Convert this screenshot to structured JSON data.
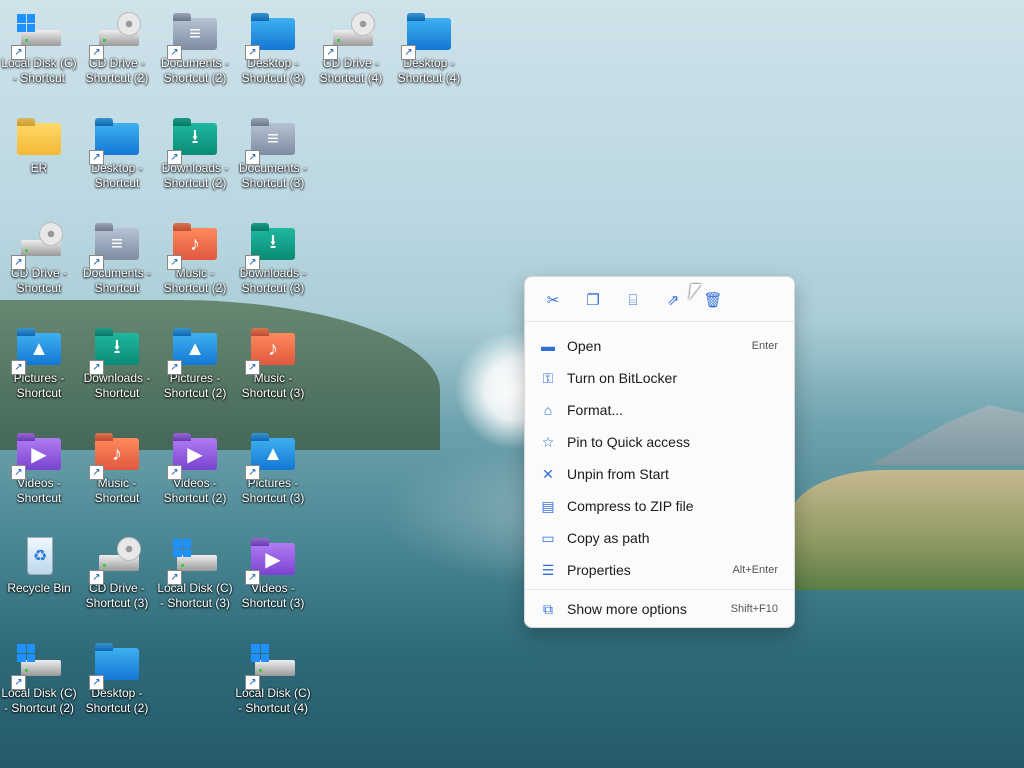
{
  "desktop": {
    "icons": [
      {
        "label": "Local Disk (C) - Shortcut",
        "kind": "win-drive",
        "shortcut": true
      },
      {
        "label": "CD Drive - Shortcut (2)",
        "kind": "cd-drive",
        "shortcut": true
      },
      {
        "label": "Documents - Shortcut (2)",
        "kind": "folder-docs",
        "shortcut": true
      },
      {
        "label": "Desktop - Shortcut (3)",
        "kind": "folder-blue",
        "shortcut": true
      },
      {
        "label": "CD Drive - Shortcut (4)",
        "kind": "cd-drive",
        "shortcut": true
      },
      {
        "label": "Desktop - Shortcut (4)",
        "kind": "folder-blue",
        "shortcut": true
      },
      {
        "label": "ER",
        "kind": "folder-yellow",
        "shortcut": false
      },
      {
        "label": "Desktop - Shortcut",
        "kind": "folder-blue",
        "shortcut": true
      },
      {
        "label": "Downloads - Shortcut (2)",
        "kind": "folder-downloads",
        "shortcut": true
      },
      {
        "label": "Documents - Shortcut (3)",
        "kind": "folder-docs",
        "shortcut": true
      },
      {
        "label": "CD Drive - Shortcut",
        "kind": "cd-drive",
        "shortcut": true
      },
      {
        "label": "Documents - Shortcut",
        "kind": "folder-docs",
        "shortcut": true
      },
      {
        "label": "Music - Shortcut (2)",
        "kind": "folder-music",
        "shortcut": true
      },
      {
        "label": "Downloads - Shortcut (3)",
        "kind": "folder-downloads",
        "shortcut": true
      },
      {
        "label": "Pictures - Shortcut",
        "kind": "folder-pictures",
        "shortcut": true
      },
      {
        "label": "Downloads - Shortcut",
        "kind": "folder-downloads",
        "shortcut": true
      },
      {
        "label": "Pictures - Shortcut (2)",
        "kind": "folder-pictures",
        "shortcut": true
      },
      {
        "label": "Music - Shortcut (3)",
        "kind": "folder-music",
        "shortcut": true
      },
      {
        "label": "Videos - Shortcut",
        "kind": "folder-videos",
        "shortcut": true
      },
      {
        "label": "Music - Shortcut",
        "kind": "folder-music",
        "shortcut": true
      },
      {
        "label": "Videos - Shortcut (2)",
        "kind": "folder-videos",
        "shortcut": true
      },
      {
        "label": "Pictures - Shortcut (3)",
        "kind": "folder-pictures",
        "shortcut": true
      },
      {
        "label": "Recycle Bin",
        "kind": "recycle-bin",
        "shortcut": false
      },
      {
        "label": "CD Drive - Shortcut (3)",
        "kind": "cd-drive",
        "shortcut": true
      },
      {
        "label": "Local Disk (C) - Shortcut (3)",
        "kind": "win-drive",
        "shortcut": true
      },
      {
        "label": "Videos - Shortcut (3)",
        "kind": "folder-videos",
        "shortcut": true
      },
      {
        "label": "Local Disk (C) - Shortcut (2)",
        "kind": "win-drive",
        "shortcut": true
      },
      {
        "label": "Desktop - Shortcut (2)",
        "kind": "folder-blue",
        "shortcut": true
      },
      {
        "label": "Local Disk (C) - Shortcut (4)",
        "kind": "win-drive",
        "shortcut": true
      }
    ]
  },
  "context_menu": {
    "toolbar": [
      {
        "name": "cut",
        "icon": "scissors-icon",
        "glyph": "✂"
      },
      {
        "name": "copy",
        "icon": "copy-icon",
        "glyph": "❐"
      },
      {
        "name": "rename",
        "icon": "rename-icon",
        "glyph": "⌸"
      },
      {
        "name": "share",
        "icon": "share-icon",
        "glyph": "⇗"
      },
      {
        "name": "delete",
        "icon": "trash-icon",
        "glyph": "🗑"
      }
    ],
    "items": [
      {
        "label": "Open",
        "shortcut": "Enter",
        "icon": "folder-open-icon",
        "glyph": "▬"
      },
      {
        "label": "Turn on BitLocker",
        "shortcut": "",
        "icon": "key-icon",
        "glyph": "⚿"
      },
      {
        "label": "Format...",
        "shortcut": "",
        "icon": "format-icon",
        "glyph": "⌂"
      },
      {
        "label": "Pin to Quick access",
        "shortcut": "",
        "icon": "star-icon",
        "glyph": "☆"
      },
      {
        "label": "Unpin from Start",
        "shortcut": "",
        "icon": "unpin-icon",
        "glyph": "✕"
      },
      {
        "label": "Compress to ZIP file",
        "shortcut": "",
        "icon": "zip-icon",
        "glyph": "▤"
      },
      {
        "label": "Copy as path",
        "shortcut": "",
        "icon": "path-icon",
        "glyph": "▭"
      },
      {
        "label": "Properties",
        "shortcut": "Alt+Enter",
        "icon": "properties-icon",
        "glyph": "☰"
      }
    ],
    "more": {
      "label": "Show more options",
      "shortcut": "Shift+F10",
      "icon": "more-options-icon",
      "glyph": "⧉"
    }
  }
}
